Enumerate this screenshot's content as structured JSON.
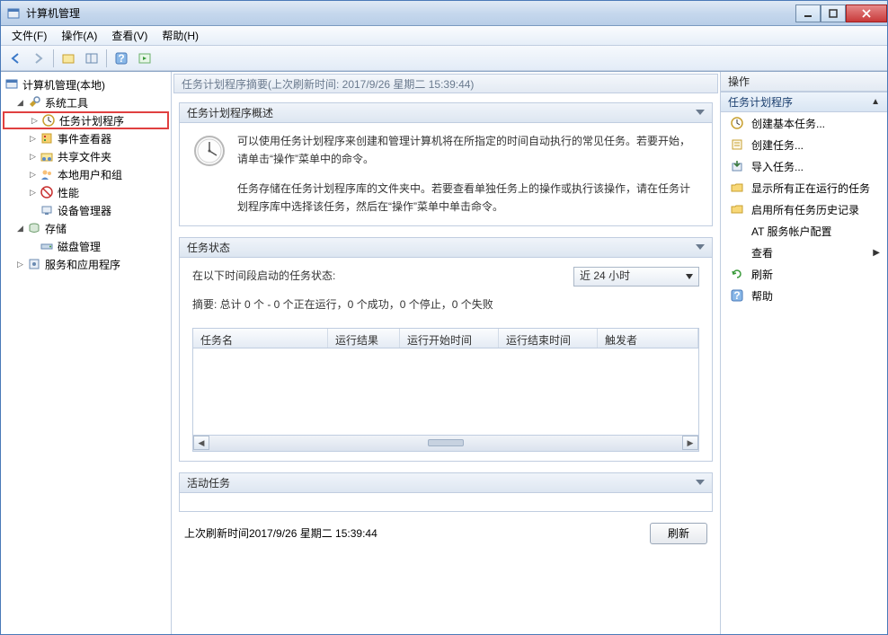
{
  "window": {
    "title": "计算机管理"
  },
  "menubar": {
    "file": "文件(F)",
    "action": "操作(A)",
    "view": "查看(V)",
    "help": "帮助(H)"
  },
  "tree": {
    "root": "计算机管理(本地)",
    "system_tools": "系统工具",
    "task_scheduler": "任务计划程序",
    "event_viewer": "事件查看器",
    "shared_folders": "共享文件夹",
    "local_users": "本地用户和组",
    "performance": "性能",
    "device_manager": "设备管理器",
    "storage": "存储",
    "disk_mgmt": "磁盘管理",
    "services_apps": "服务和应用程序"
  },
  "center": {
    "header": "任务计划程序摘要(上次刷新时间: 2017/9/26 星期二 15:39:44)",
    "overview": {
      "title": "任务计划程序概述",
      "p1": "可以使用任务计划程序来创建和管理计算机将在所指定的时间自动执行的常见任务。若要开始，请单击“操作”菜单中的命令。",
      "p2": "任务存储在任务计划程序库的文件夹中。若要查看单独任务上的操作或执行该操作，请在任务计划程序库中选择该任务，然后在“操作”菜单中单击命令。"
    },
    "status": {
      "title": "任务状态",
      "period_label": "在以下时间段启动的任务状态:",
      "period_value": "近 24 小时",
      "summary": "摘要: 总计 0 个 - 0 个正在运行，0 个成功，0 个停止，0 个失败",
      "cols": {
        "c1": "任务名",
        "c2": "运行结果",
        "c3": "运行开始时间",
        "c4": "运行结束时间",
        "c5": "触发者"
      }
    },
    "active": {
      "title": "活动任务"
    },
    "footer": {
      "last_refresh": "上次刷新时间2017/9/26 星期二 15:39:44",
      "refresh_btn": "刷新"
    }
  },
  "actions": {
    "title": "操作",
    "group": "任务计划程序",
    "items": {
      "create_basic": "创建基本任务...",
      "create_task": "创建任务...",
      "import_task": "导入任务...",
      "show_running": "显示所有正在运行的任务",
      "enable_history": "启用所有任务历史记录",
      "at_account": "AT 服务帐户配置",
      "view": "查看",
      "refresh": "刷新",
      "help": "帮助"
    }
  }
}
